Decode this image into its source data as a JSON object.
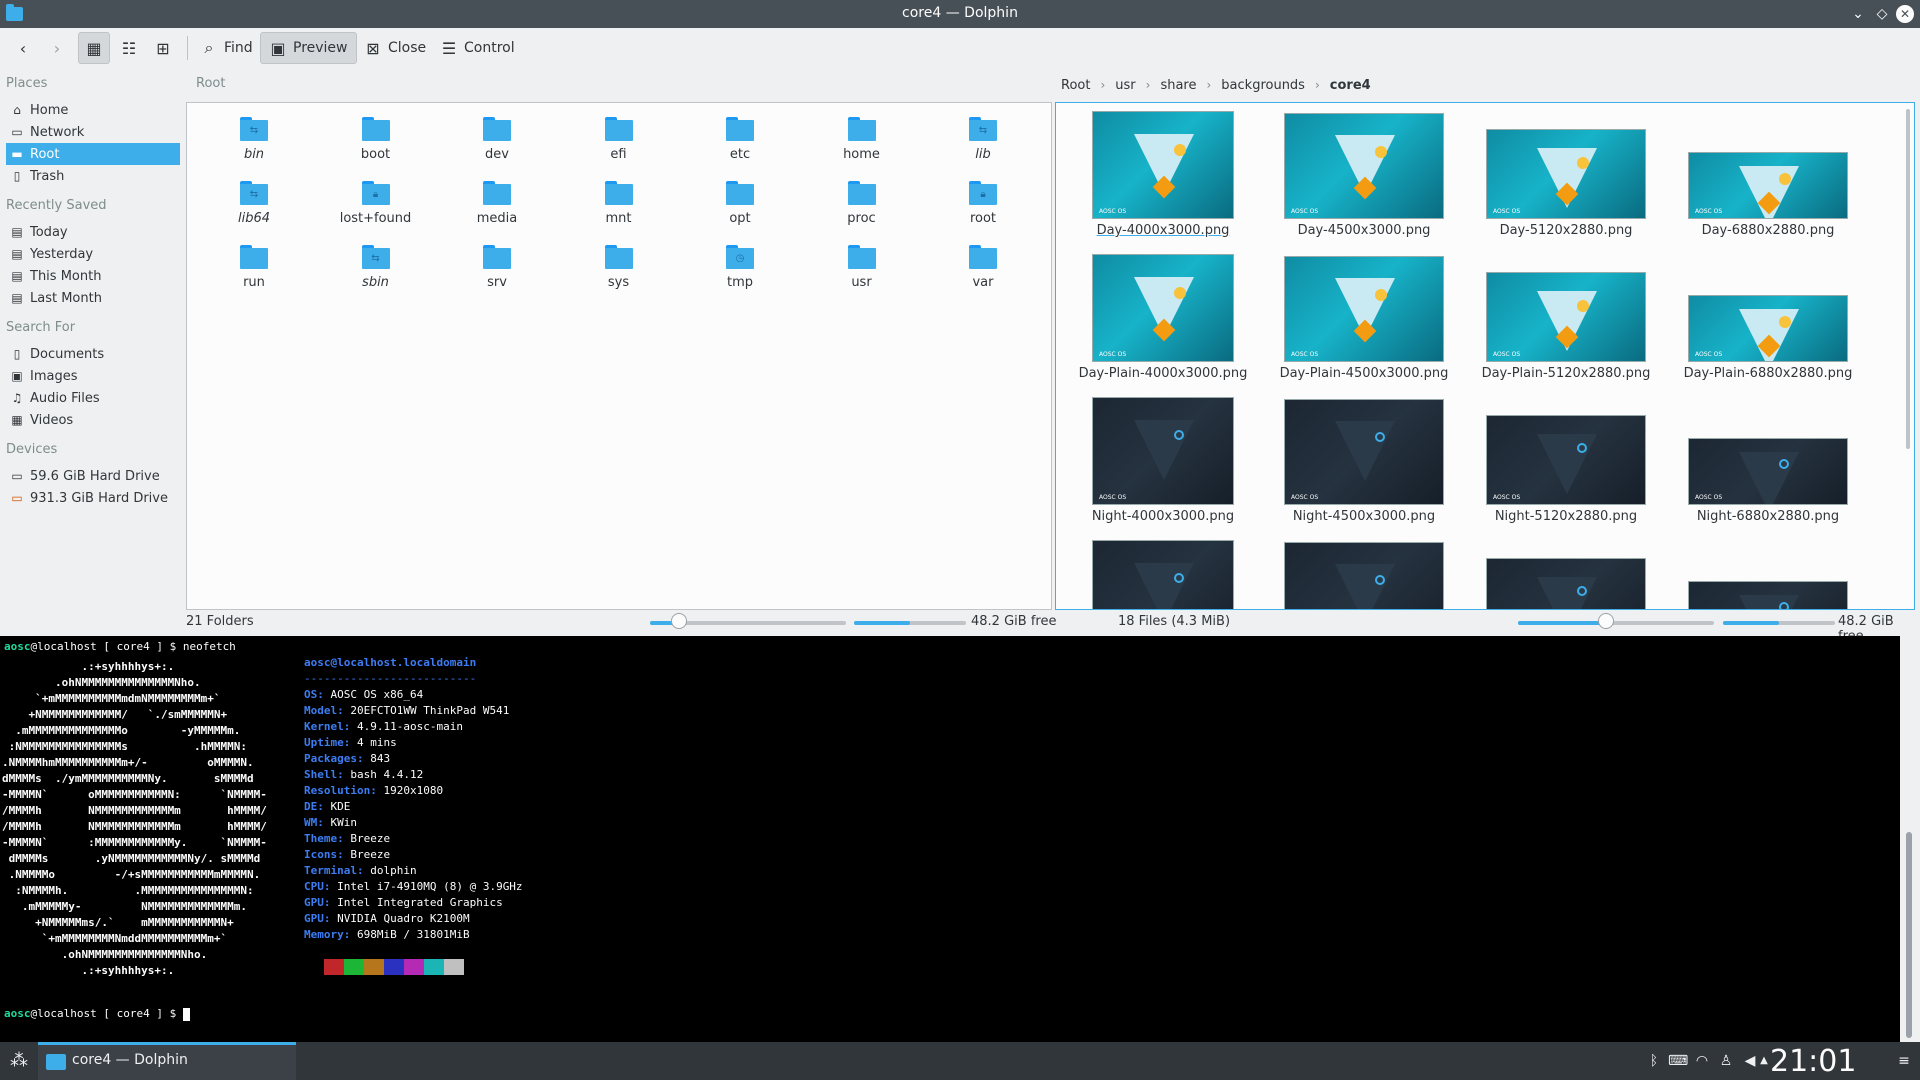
{
  "window": {
    "title": "core4 — Dolphin"
  },
  "toolbar": {
    "find": "Find",
    "preview": "Preview",
    "close": "Close",
    "control": "Control"
  },
  "sidebar": {
    "places_head": "Places",
    "places": [
      "Home",
      "Network",
      "Root",
      "Trash"
    ],
    "recent_head": "Recently Saved",
    "recent": [
      "Today",
      "Yesterday",
      "This Month",
      "Last Month"
    ],
    "search_head": "Search For",
    "search": [
      "Documents",
      "Images",
      "Audio Files",
      "Videos"
    ],
    "devices_head": "Devices",
    "devices": [
      "59.6 GiB Hard Drive",
      "931.3 GiB Hard Drive"
    ]
  },
  "left_pane": {
    "label": "Root",
    "folders": [
      "bin",
      "boot",
      "dev",
      "efi",
      "etc",
      "home",
      "lib",
      "lib64",
      "lost+found",
      "media",
      "mnt",
      "opt",
      "proc",
      "root",
      "run",
      "sbin",
      "srv",
      "sys",
      "tmp",
      "usr",
      "var"
    ],
    "status_count": "21 Folders",
    "status_free": "48.2 GiB free"
  },
  "breadcrumb": [
    "Root",
    "usr",
    "share",
    "backgrounds",
    "core4"
  ],
  "right_pane": {
    "files": [
      "Day-4000x3000.png",
      "Day-4500x3000.png",
      "Day-5120x2880.png",
      "Day-6880x2880.png",
      "Day-Plain-4000x3000.png",
      "Day-Plain-4500x3000.png",
      "Day-Plain-5120x2880.png",
      "Day-Plain-6880x2880.png",
      "Night-4000x3000.png",
      "Night-4500x3000.png",
      "Night-5120x2880.png",
      "Night-6880x2880.png"
    ],
    "status_count": "18 Files (4.3 MiB)",
    "status_free": "48.2 GiB free"
  },
  "terminal": {
    "prompt_user": "aosc",
    "prompt_rest": "@localhost [ core4 ] $ ",
    "command": "neofetch",
    "ascii": [
      "            .:+syhhhhys+:.",
      "        .ohNMMMMMMMMMMMMMMNho.",
      "     `+mMMMMMMMMMMmdmNMMMMMMMMm+`",
      "    +NMMMMMMMMMMMM/   `./smMMMMMN+",
      "  .mMMMMMMMMMMMMMMo        -yMMMMMm.",
      " :NMMMMMMMMMMMMMMMs          .hMMMMN:",
      ".NMMMMhmMMMMMMMMMMm+/-         oMMMMN.",
      "dMMMMs  ./ymMMMMMMMMMMNy.       sMMMMd",
      "-MMMMN`      oMMMMMMMMMMMN:      `NMMMM-",
      "/MMMMh       NMMMMMMMMMMMMm       hMMMM/",
      "/MMMMh       NMMMMMMMMMMMMm       hMMMM/",
      "-MMMMN`      :MMMMMMMMMMMMy.     `NMMMM-",
      " dMMMMs       .yNMMMMMMMMMMMNy/. sMMMMd",
      " .NMMMMo         -/+sMMMMMMMMMMMmMMMMN.",
      "  :NMMMMh.          .MMMMMMMMMMMMMMMN:",
      "   .mMMMMMy-         NMMMMMMMMMMMMMm.",
      "     +NMMMMMms/.`    mMMMMMMMMMMMN+",
      "      `+mMMMMMMMMNmddMMMMMMMMMMm+`",
      "         .ohNMMMMMMMMMMMMMMNho.",
      "            .:+syhhhhys+:."
    ],
    "host": "aosc@localhost.localdomain",
    "rule": "--------------------------",
    "info": [
      {
        "k": "OS",
        "v": "AOSC OS x86_64"
      },
      {
        "k": "Model",
        "v": "20EFCTO1WW ThinkPad W541"
      },
      {
        "k": "Kernel",
        "v": "4.9.11-aosc-main"
      },
      {
        "k": "Uptime",
        "v": "4 mins"
      },
      {
        "k": "Packages",
        "v": "843"
      },
      {
        "k": "Shell",
        "v": "bash 4.4.12"
      },
      {
        "k": "Resolution",
        "v": "1920x1080"
      },
      {
        "k": "DE",
        "v": "KDE"
      },
      {
        "k": "WM",
        "v": "KWin"
      },
      {
        "k": "Theme",
        "v": "Breeze"
      },
      {
        "k": "Icons",
        "v": "Breeze"
      },
      {
        "k": "Terminal",
        "v": "dolphin"
      },
      {
        "k": "CPU",
        "v": "Intel i7-4910MQ (8) @ 3.9GHz"
      },
      {
        "k": "GPU",
        "v": "Intel Integrated Graphics"
      },
      {
        "k": "GPU",
        "v": "NVIDIA Quadro K2100M"
      },
      {
        "k": "Memory",
        "v": "698MiB / 31801MiB"
      }
    ],
    "swatches": [
      "#000000",
      "#c0262a",
      "#1cb535",
      "#b5761c",
      "#2a30c0",
      "#b52ab5",
      "#1cb5b5",
      "#c0c0c0"
    ]
  },
  "taskbar": {
    "task_label": "core4 — Dolphin",
    "clock": "21:01"
  },
  "zoom": {
    "left": 0.15,
    "right": 0.45
  },
  "free_space": {
    "left": 0.5,
    "right": 0.5
  }
}
